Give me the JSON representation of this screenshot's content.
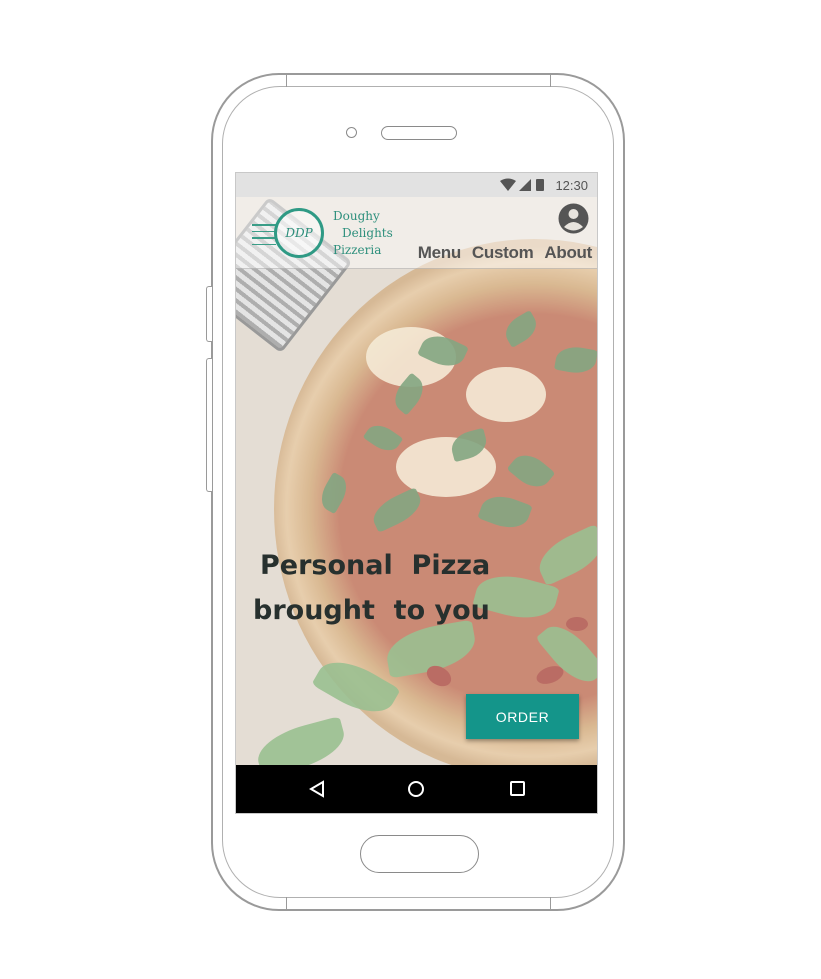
{
  "status_bar": {
    "time": "12:30",
    "icons": [
      "wifi-icon",
      "signal-icon",
      "battery-icon"
    ]
  },
  "header": {
    "logo_monogram": "DDP",
    "logo_lines": [
      "Doughy",
      "Delights",
      "Pizzeria"
    ],
    "nav": [
      "Menu",
      "Custom",
      "About"
    ],
    "account_icon": "account-circle-icon"
  },
  "hero": {
    "tagline_line1": "Personal  Pizza",
    "tagline_line2": "brought  to you"
  },
  "order_button": {
    "label": "ORDER"
  },
  "android_nav": [
    "back-icon",
    "home-icon",
    "recents-icon"
  ],
  "colors": {
    "accent": "#14958a",
    "logo": "#2d8f7c",
    "status_bar": "#e2e2e2",
    "nav_bar": "#000000"
  }
}
